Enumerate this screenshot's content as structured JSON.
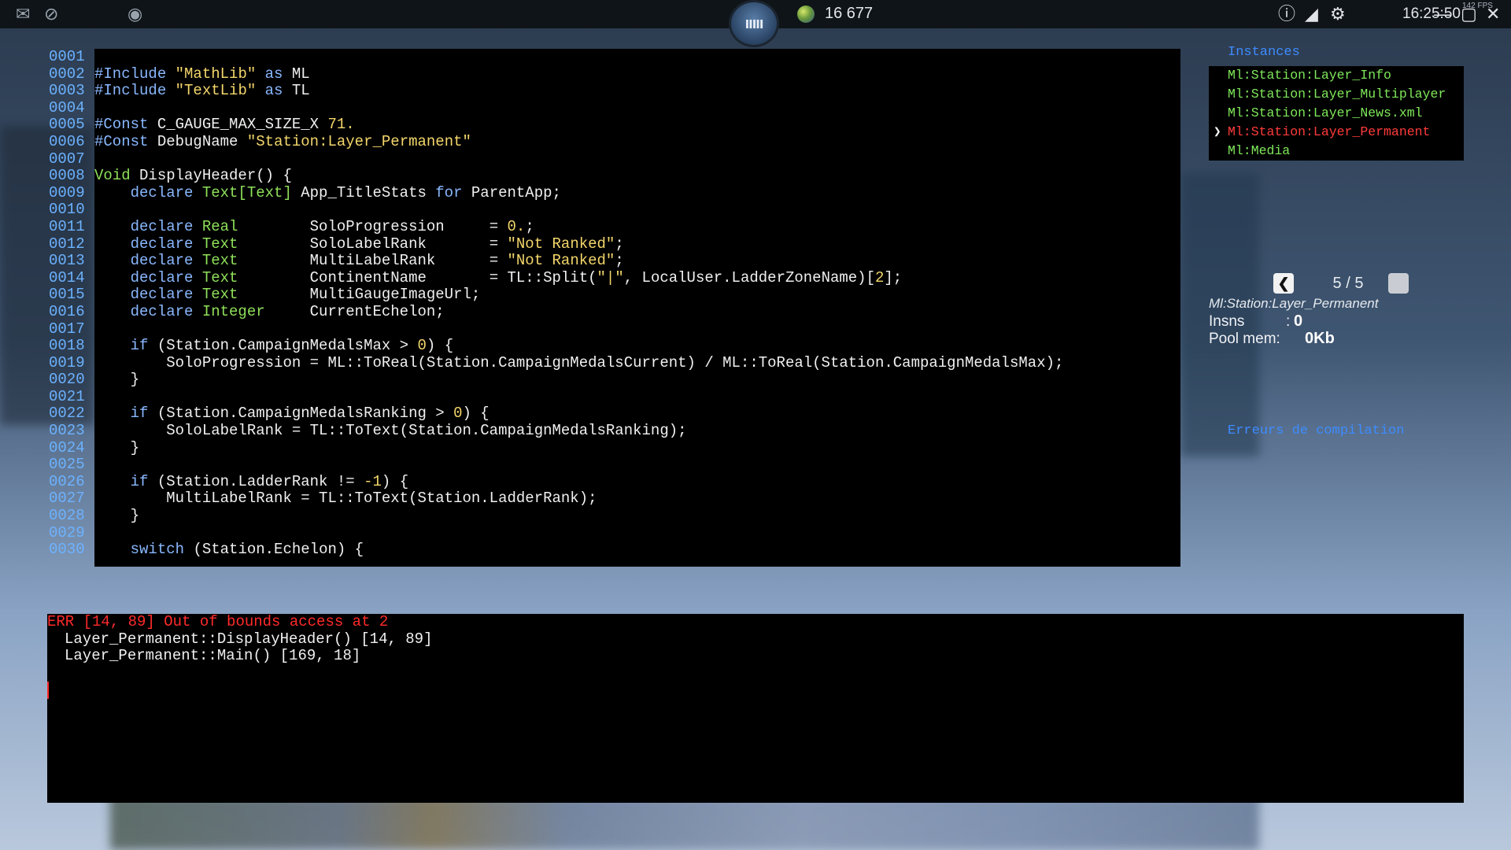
{
  "topbar": {
    "planets": "16 677",
    "clock": "16:25:50",
    "fps": "142 FPS",
    "logo_text": "ııııı"
  },
  "editor": {
    "line_numbers": [
      "0001",
      "0002",
      "0003",
      "0004",
      "0005",
      "0006",
      "0007",
      "0008",
      "0009",
      "0010",
      "0011",
      "0012",
      "0013",
      "0014",
      "0015",
      "0016",
      "0017",
      "0018",
      "0019",
      "0020",
      "0021",
      "0022",
      "0023",
      "0024",
      "0025",
      "0026",
      "0027",
      "0028",
      "0029",
      "0030"
    ]
  },
  "instances": {
    "title": "Instances",
    "items": [
      {
        "label": "Ml:Station:Layer_Info",
        "active": false
      },
      {
        "label": "Ml:Station:Layer_Multiplayer",
        "active": false
      },
      {
        "label": "Ml:Station:Layer_News.xml",
        "active": false
      },
      {
        "label": "Ml:Station:Layer_Permanent",
        "active": true
      },
      {
        "label": "Ml:Media",
        "active": false
      }
    ],
    "arrow": "❯"
  },
  "pager": {
    "label": "5 / 5",
    "prev": "❮"
  },
  "stats": {
    "name": "Ml:Station:Layer_Permanent",
    "insns_label": "Insns",
    "insns_sep": ":",
    "insns_value": "0",
    "pool_label": "Pool mem:",
    "pool_value": "0Kb"
  },
  "compile_link": "Erreurs de compilation",
  "console": {
    "error": "ERR [14, 89] Out of bounds access at 2",
    "trace": [
      "Layer_Permanent::DisplayHeader() [14, 89]",
      "Layer_Permanent::Main() [169, 18]"
    ]
  },
  "colors": {
    "keyword": "#89b8ff",
    "type": "#8ee05a",
    "string": "#f3d66a",
    "error": "#ff2a2a",
    "link": "#3d8cff",
    "instance": "#7ee85a"
  }
}
